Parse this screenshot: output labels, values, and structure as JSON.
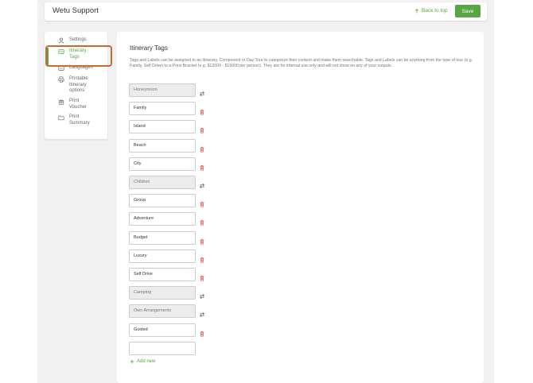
{
  "header": {
    "title": "Wetu Support",
    "back_to_top": "Back to top",
    "save_label": "Save"
  },
  "sidebar": {
    "items": [
      {
        "label": "Settings",
        "icon": "user-icon"
      },
      {
        "label": "Itinerary Tags",
        "icon": "tag-icon",
        "active": true
      },
      {
        "label": "Languages",
        "icon": "languages-icon"
      },
      {
        "label": "Printable Itinerary options",
        "icon": "printer-icon"
      },
      {
        "label": "Print Voucher",
        "icon": "gift-icon"
      },
      {
        "label": "Print Summary",
        "icon": "folder-icon"
      }
    ]
  },
  "main": {
    "title": "Itinerary Tags",
    "description": "Tags and Labels can be assigned to an Itinerary, Component or Day Tour to categorize their content and make them searchable. Tags and Labels can be anything from the type of tour (e.g. Family, Self Drive) to a Price Bracket (e.g. $12000 - $15000 per person). They are for internal use only and will not show on any of your outputs.",
    "tags": [
      {
        "label": "Honeymoon",
        "system": true
      },
      {
        "label": "Family",
        "system": false
      },
      {
        "label": "Island",
        "system": false
      },
      {
        "label": "Beach",
        "system": false
      },
      {
        "label": "City",
        "system": false
      },
      {
        "label": "Children",
        "system": true
      },
      {
        "label": "Group",
        "system": false
      },
      {
        "label": "Adventure",
        "system": false
      },
      {
        "label": "Budget",
        "system": false
      },
      {
        "label": "Luxury",
        "system": false
      },
      {
        "label": "Self Drive",
        "system": false
      },
      {
        "label": "Camping",
        "system": true
      },
      {
        "label": "Own Arrangements",
        "system": true
      },
      {
        "label": "Guided",
        "system": false
      },
      {
        "label": "",
        "system": false,
        "empty": true
      }
    ],
    "add_new": "Add new"
  },
  "colors": {
    "accent": "#5aa644",
    "delete": "#d9534f",
    "highlight": "#c76a33"
  }
}
